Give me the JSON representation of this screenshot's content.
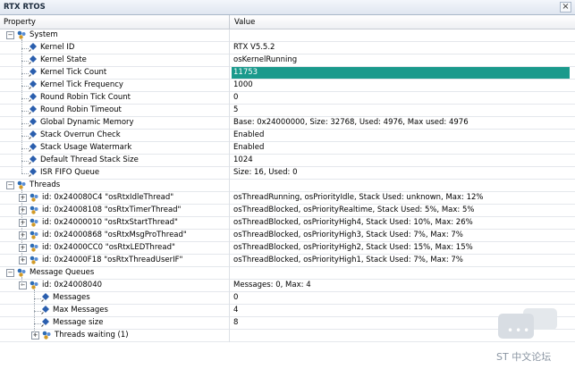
{
  "window": {
    "title": "RTX RTOS",
    "close_glyph": "×"
  },
  "header": {
    "property": "Property",
    "value": "Value"
  },
  "rows": [
    {
      "level": 0,
      "type": "group",
      "expander": "-",
      "label": "System",
      "value": ""
    },
    {
      "level": 1,
      "type": "prop",
      "label": "Kernel ID",
      "value": "RTX V5.5.2"
    },
    {
      "level": 1,
      "type": "prop",
      "label": "Kernel State",
      "value": "osKernelRunning"
    },
    {
      "level": 1,
      "type": "prop",
      "label": "Kernel Tick Count",
      "value": "11753",
      "highlight": true
    },
    {
      "level": 1,
      "type": "prop",
      "label": "Kernel Tick Frequency",
      "value": "1000"
    },
    {
      "level": 1,
      "type": "prop",
      "label": "Round Robin Tick Count",
      "value": "0"
    },
    {
      "level": 1,
      "type": "prop",
      "label": "Round Robin Timeout",
      "value": "5"
    },
    {
      "level": 1,
      "type": "prop",
      "label": "Global Dynamic Memory",
      "value": "Base: 0x24000000, Size: 32768, Used: 4976, Max used: 4976"
    },
    {
      "level": 1,
      "type": "prop",
      "label": "Stack Overrun Check",
      "value": "Enabled"
    },
    {
      "level": 1,
      "type": "prop",
      "label": "Stack Usage Watermark",
      "value": "Enabled"
    },
    {
      "level": 1,
      "type": "prop",
      "label": "Default Thread Stack Size",
      "value": "1024"
    },
    {
      "level": 1,
      "type": "prop",
      "label": "ISR FIFO Queue",
      "value": "Size: 16, Used: 0"
    },
    {
      "level": 0,
      "type": "group",
      "expander": "-",
      "label": "Threads",
      "value": ""
    },
    {
      "level": 1,
      "type": "subgroup",
      "expander": "+",
      "label": "id: 0x240080C4 \"osRtxIdleThread\"",
      "value": "osThreadRunning, osPriorityIdle, Stack Used: unknown, Max: 12%"
    },
    {
      "level": 1,
      "type": "subgroup",
      "expander": "+",
      "label": "id: 0x24008108 \"osRtxTimerThread\"",
      "value": "osThreadBlocked, osPriorityRealtime, Stack Used: 5%, Max: 5%"
    },
    {
      "level": 1,
      "type": "subgroup",
      "expander": "+",
      "label": "id: 0x24000010 \"osRtxStartThread\"",
      "value": "osThreadBlocked, osPriorityHigh4, Stack Used: 10%, Max: 26%"
    },
    {
      "level": 1,
      "type": "subgroup",
      "expander": "+",
      "label": "id: 0x24000868 \"osRtxMsgProThread\"",
      "value": "osThreadBlocked, osPriorityHigh3, Stack Used: 7%, Max: 7%"
    },
    {
      "level": 1,
      "type": "subgroup",
      "expander": "+",
      "label": "id: 0x24000CC0 \"osRtxLEDThread\"",
      "value": "osThreadBlocked, osPriorityHigh2, Stack Used: 15%, Max: 15%"
    },
    {
      "level": 1,
      "type": "subgroup",
      "expander": "+",
      "label": "id: 0x24000F18 \"osRtxThreadUserIF\"",
      "value": "osThreadBlocked, osPriorityHigh1, Stack Used: 7%, Max: 7%"
    },
    {
      "level": 0,
      "type": "group",
      "expander": "-",
      "label": "Message Queues",
      "value": ""
    },
    {
      "level": 1,
      "type": "subgroup",
      "expander": "-",
      "label": "id: 0x24008040",
      "value": "Messages: 0, Max: 4"
    },
    {
      "level": 2,
      "type": "prop",
      "label": "Messages",
      "value": "0"
    },
    {
      "level": 2,
      "type": "prop",
      "label": "Max Messages",
      "value": "4"
    },
    {
      "level": 2,
      "type": "prop",
      "label": "Message size",
      "value": "8"
    },
    {
      "level": 2,
      "type": "subgroup",
      "expander": "+",
      "label": "Threads waiting (1)",
      "value": ""
    }
  ],
  "watermark": {
    "text": "ST 中文论坛"
  },
  "colors": {
    "highlight": "#1a9a8c",
    "group_icon_blue": "#2f6db5",
    "pin_blue": "#2b5fae"
  },
  "icons": {
    "group": "gear-group-icon",
    "property": "pin-icon",
    "expand": "plus-box-icon",
    "collapse": "minus-box-icon"
  }
}
